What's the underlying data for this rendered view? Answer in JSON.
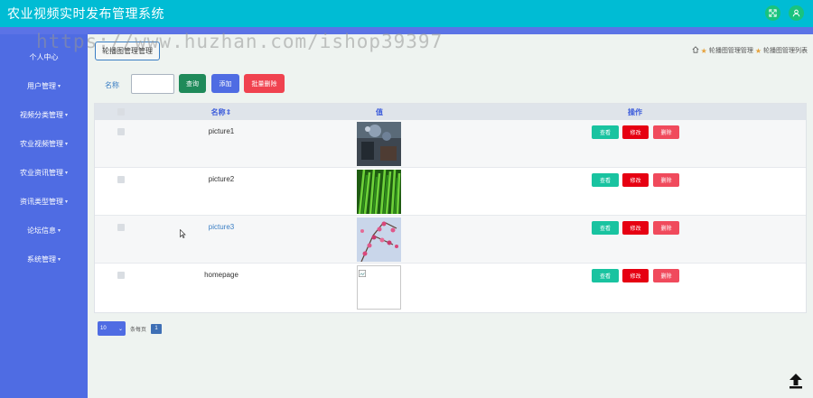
{
  "header": {
    "title": "农业视频实时发布管理系统"
  },
  "sidebar": {
    "items": [
      {
        "label": "个人中心"
      },
      {
        "label": "用户管理"
      },
      {
        "label": "视频分类管理"
      },
      {
        "label": "农业视频管理"
      },
      {
        "label": "农业资讯管理"
      },
      {
        "label": "资讯类型管理"
      },
      {
        "label": "论坛信息"
      },
      {
        "label": "系统管理"
      }
    ]
  },
  "watermark": "https://www.huzhan.com/ishop39397",
  "page_tab": "轮播图管理管理",
  "breadcrumb": {
    "first": "轮播图管理管理",
    "second": "轮播图管理列表"
  },
  "search": {
    "label": "名称",
    "value": "",
    "query_label": "查询",
    "add_label": "添加",
    "batch_delete_label": "批量删除"
  },
  "table": {
    "headers": {
      "name": "名称",
      "sort_icon": "⇕",
      "value": "值",
      "actions": "操作"
    },
    "rows": [
      {
        "name": "picture1",
        "image": "dark-photo"
      },
      {
        "name": "picture2",
        "image": "green-grass"
      },
      {
        "name": "picture3",
        "image": "pink-blossom"
      },
      {
        "name": "homepage",
        "image": "broken-image"
      }
    ],
    "view_label": "查看",
    "edit_label": "修改",
    "delete_label": "删除"
  },
  "pagination": {
    "page_size": "10",
    "per_page_text": "条每页",
    "current_page": "1"
  },
  "colors": {
    "topbar": "#00bcd4",
    "sidebar": "#4f6ce3",
    "query": "#1f8a5a",
    "add": "#4f6ce3",
    "batch_delete": "#f0424f",
    "view": "#19c3a0",
    "edit": "#e60012",
    "delete": "#f04a5c"
  }
}
